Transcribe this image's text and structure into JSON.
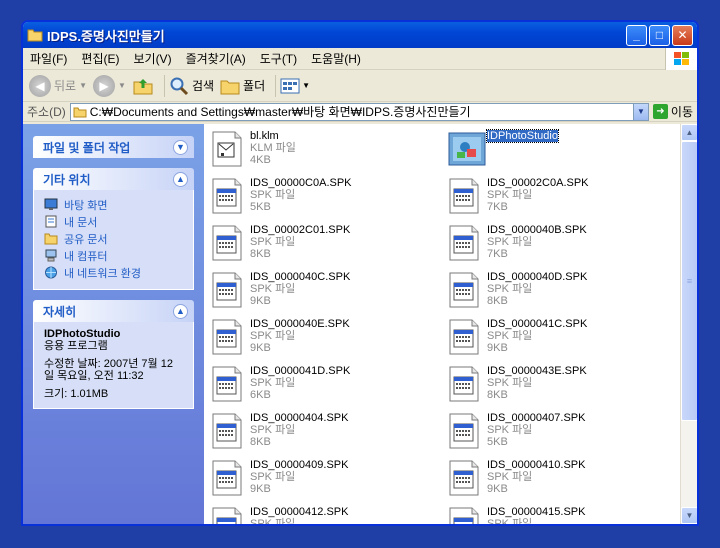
{
  "window": {
    "title": "IDPS.증명사진만들기"
  },
  "menu": [
    "파일(F)",
    "편집(E)",
    "보기(V)",
    "즐겨찾기(A)",
    "도구(T)",
    "도움말(H)"
  ],
  "toolbar": {
    "back": "뒤로",
    "search": "검색",
    "folders": "폴더"
  },
  "address": {
    "label": "주소(D)",
    "path": "C:₩Documents and Settings₩master₩바탕 화면₩IDPS.증명사진만들기",
    "go": "이동"
  },
  "tasks": {
    "file_folder": {
      "title": "파일 및 폴더 작업"
    },
    "other": {
      "title": "기타 위치",
      "links": [
        "바탕 화면",
        "내 문서",
        "공유 문서",
        "내 컴퓨터",
        "내 네트워크 환경"
      ]
    },
    "details": {
      "title": "자세히",
      "name": "IDPhotoStudio",
      "type": "응용 프로그램",
      "modified_1": "수정한 날짜: 2007년 7월 12",
      "modified_2": "일 목요일, 오전 11:32",
      "size": "크기: 1.01MB"
    }
  },
  "files": [
    {
      "name": "bl.klm",
      "type": "KLM 파일",
      "size": "4KB",
      "icon": "klm-file-icon"
    },
    {
      "name": "IDPhotoStudio",
      "type": "",
      "size": "",
      "icon": "app-icon",
      "selected": true
    },
    {
      "name": "IDS_00000C0A.SPK",
      "type": "SPK 파일",
      "size": "5KB",
      "icon": "spk-file-icon"
    },
    {
      "name": "IDS_00002C0A.SPK",
      "type": "SPK 파일",
      "size": "7KB",
      "icon": "spk-file-icon"
    },
    {
      "name": "IDS_00002C01.SPK",
      "type": "SPK 파일",
      "size": "8KB",
      "icon": "spk-file-icon"
    },
    {
      "name": "IDS_0000040B.SPK",
      "type": "SPK 파일",
      "size": "7KB",
      "icon": "spk-file-icon"
    },
    {
      "name": "IDS_0000040C.SPK",
      "type": "SPK 파일",
      "size": "9KB",
      "icon": "spk-file-icon"
    },
    {
      "name": "IDS_0000040D.SPK",
      "type": "SPK 파일",
      "size": "8KB",
      "icon": "spk-file-icon"
    },
    {
      "name": "IDS_0000040E.SPK",
      "type": "SPK 파일",
      "size": "9KB",
      "icon": "spk-file-icon"
    },
    {
      "name": "IDS_0000041C.SPK",
      "type": "SPK 파일",
      "size": "9KB",
      "icon": "spk-file-icon"
    },
    {
      "name": "IDS_0000041D.SPK",
      "type": "SPK 파일",
      "size": "6KB",
      "icon": "spk-file-icon"
    },
    {
      "name": "IDS_0000043E.SPK",
      "type": "SPK 파일",
      "size": "8KB",
      "icon": "spk-file-icon"
    },
    {
      "name": "IDS_00000404.SPK",
      "type": "SPK 파일",
      "size": "8KB",
      "icon": "spk-file-icon"
    },
    {
      "name": "IDS_00000407.SPK",
      "type": "SPK 파일",
      "size": "5KB",
      "icon": "spk-file-icon"
    },
    {
      "name": "IDS_00000409.SPK",
      "type": "SPK 파일",
      "size": "9KB",
      "icon": "spk-file-icon"
    },
    {
      "name": "IDS_00000410.SPK",
      "type": "SPK 파일",
      "size": "9KB",
      "icon": "spk-file-icon"
    },
    {
      "name": "IDS_00000412.SPK",
      "type": "SPK 파일",
      "size": "",
      "icon": "spk-file-icon"
    },
    {
      "name": "IDS_00000415.SPK",
      "type": "SPK 파일",
      "size": "",
      "icon": "spk-file-icon"
    }
  ]
}
